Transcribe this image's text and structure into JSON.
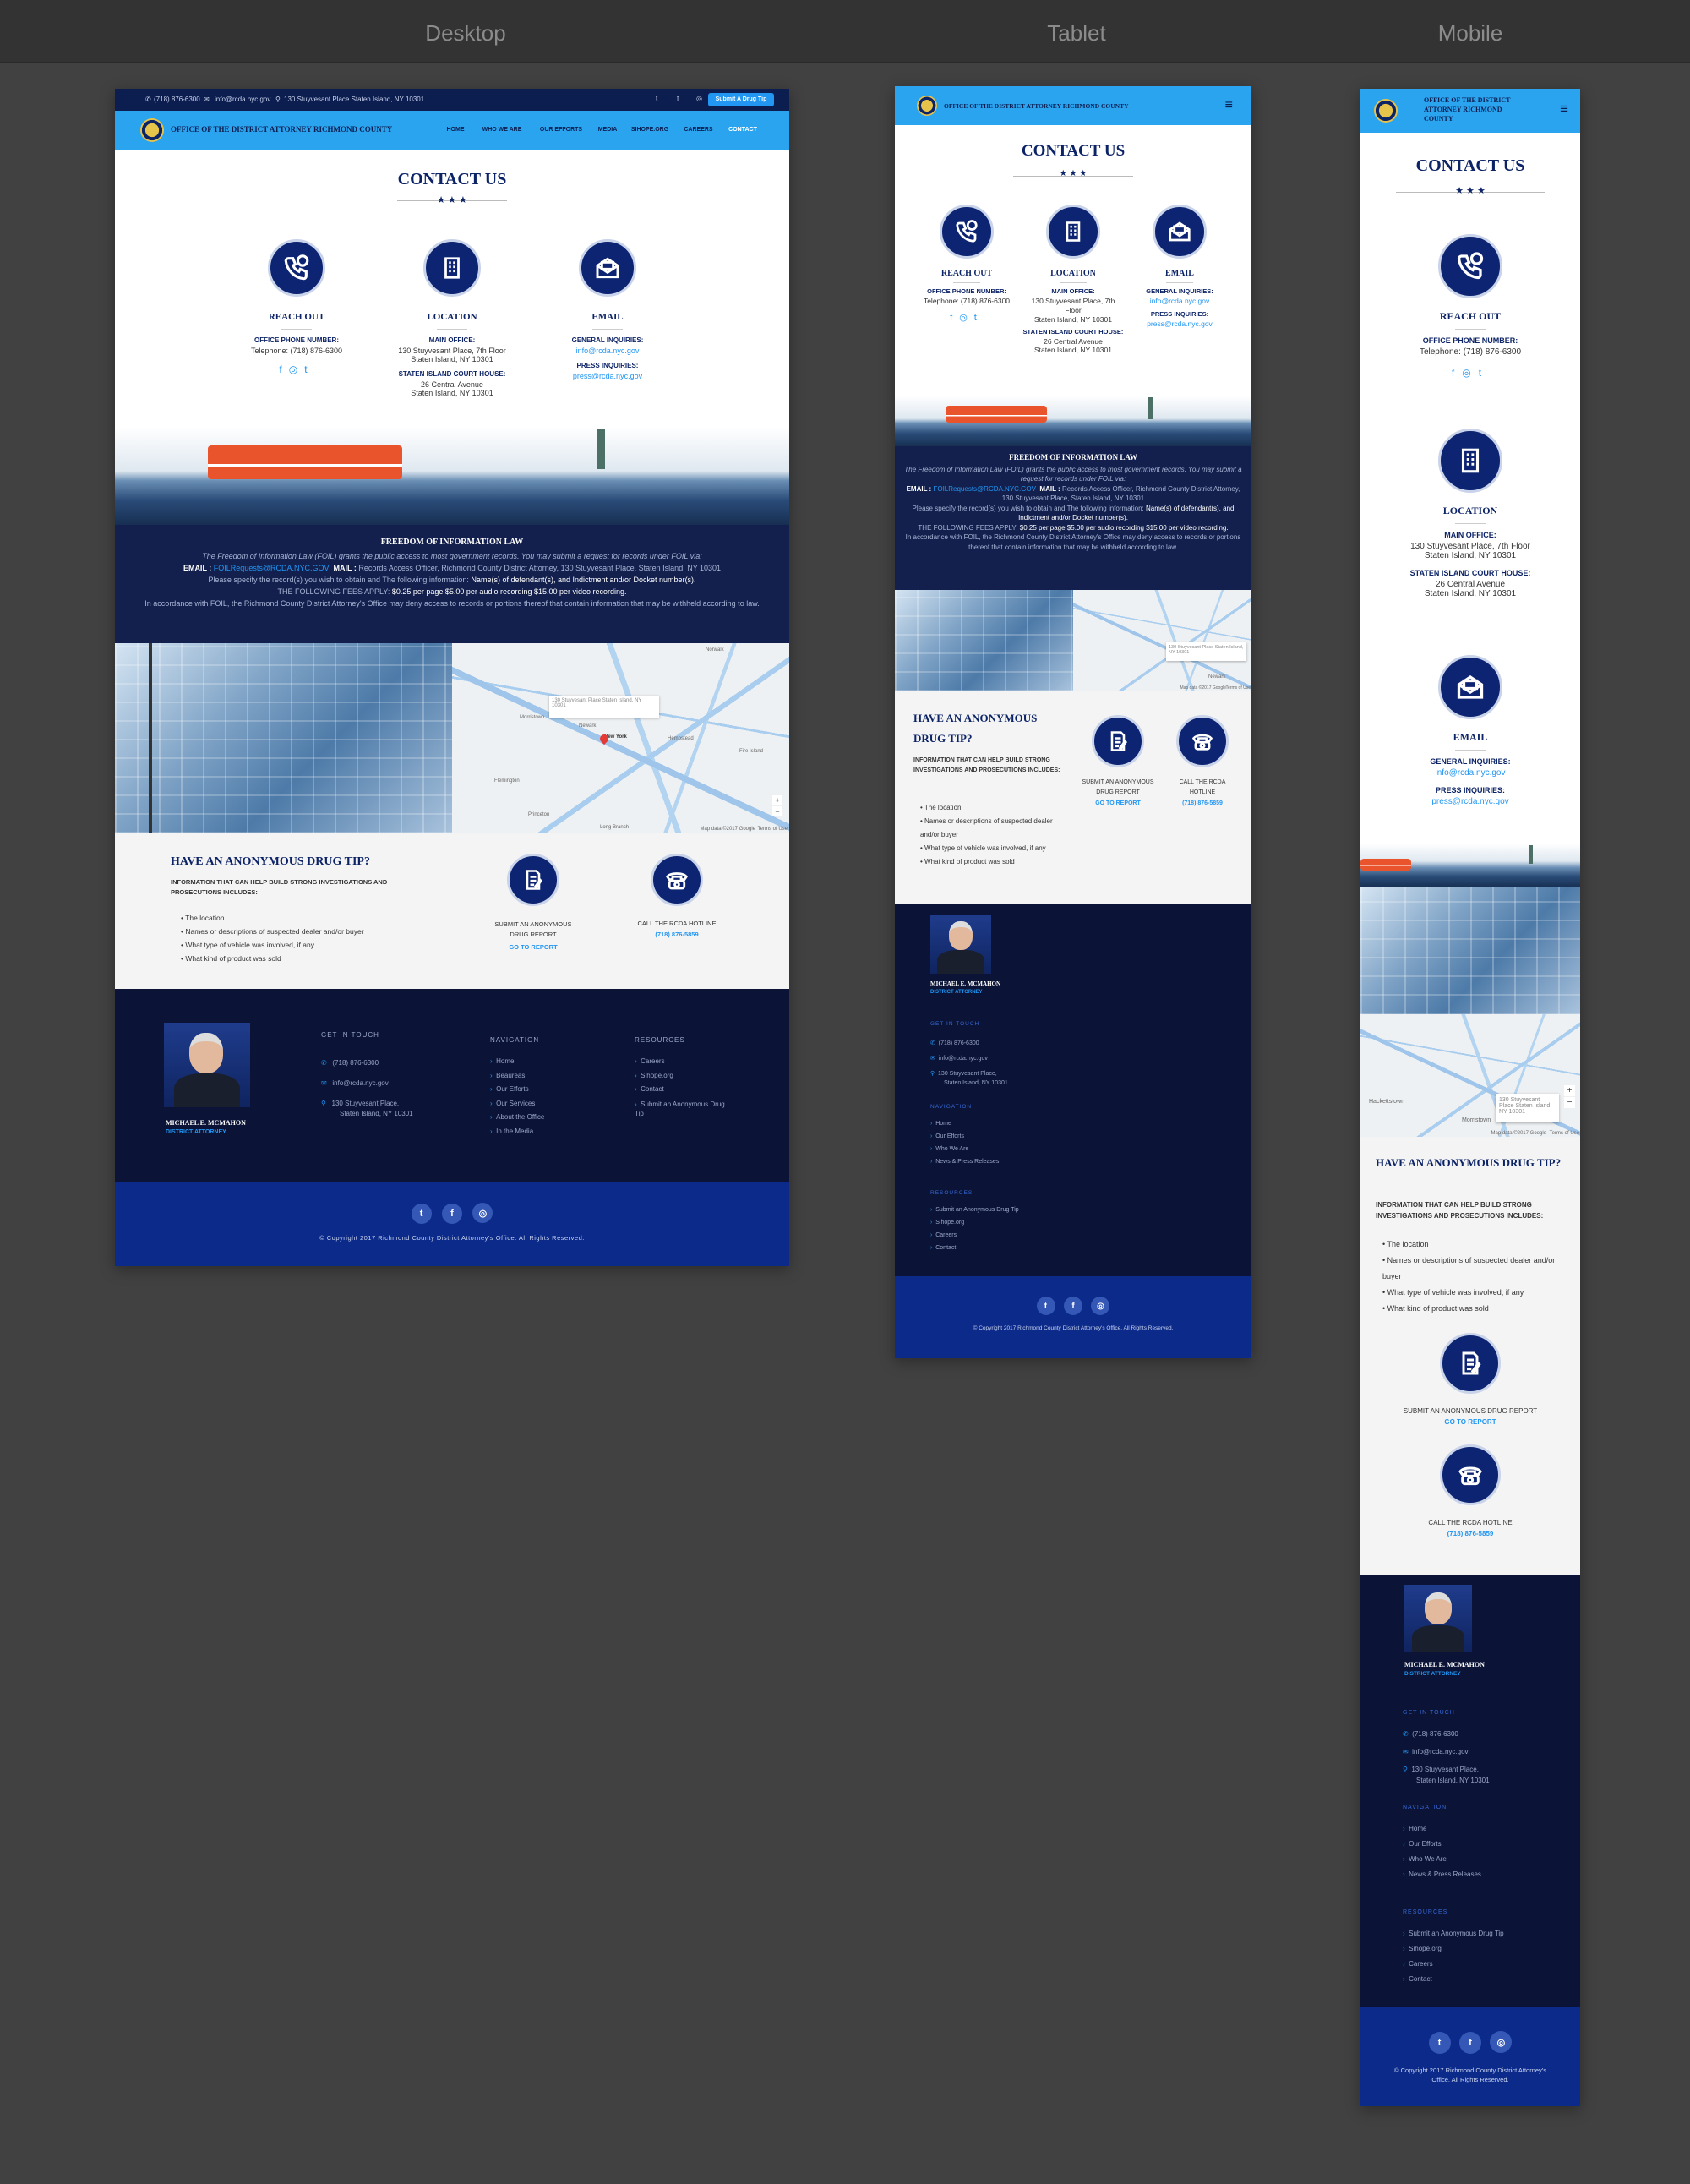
{
  "labels": {
    "desktop": "Desktop",
    "tablet": "Tablet",
    "mobile": "Mobile"
  },
  "topbar": {
    "phone": "(718) 876-6300",
    "email": "info@rcda.nyc.gov",
    "address": "130 Stuyvesant Place Staten Island, NY 10301",
    "cta": "Submit A Drug Tip"
  },
  "brand": {
    "office": "OFFICE OF THE DISTRICT ATTORNEY RICHMOND COUNTY"
  },
  "nav": [
    "HOME",
    "WHO WE ARE",
    "OUR EFFORTS",
    "MEDIA",
    "SIHOPE.ORG",
    "CAREERS",
    "CONTACT"
  ],
  "contact": {
    "title": "CONTACT US",
    "stars": "★ ★ ★",
    "reach": {
      "h": "REACH OUT",
      "l1": "OFFICE PHONE NUMBER:",
      "v1": "Telephone: (718) 876-6300"
    },
    "loc": {
      "h": "LOCATION",
      "l1": "MAIN OFFICE:",
      "v1a": "130 Stuyvesant Place, 7th Floor",
      "v1b": "Staten Island, NY 10301",
      "l2": "STATEN ISLAND COURT HOUSE:",
      "v2a": "26 Central Avenue",
      "v2b": "Staten Island, NY 10301"
    },
    "email": {
      "h": "EMAIL",
      "l1": "GENERAL INQUIRIES:",
      "v1": "info@rcda.nyc.gov",
      "l2": "PRESS INQUIRIES:",
      "v2": "press@rcda.nyc.gov"
    }
  },
  "foil": {
    "title": "FREEDOM OF INFORMATION LAW",
    "intro": "The Freedom of Information Law (FOIL) grants the public access to most government records. You may submit a request for records under FOIL via:",
    "email_label": "EMAIL :",
    "email": "FOILRequests@RCDA.NYC.GOV",
    "mail_label": "MAIL :",
    "mail": "Records Access Officer, Richmond County District Attorney, 130 Stuyvesant Place, Staten Island, NY 10301",
    "specify": "Please specify the record(s) you wish to obtain and The following information:",
    "specify_b": "Name(s) of defendant(s), and Indictment and/or Docket number(s).",
    "fees_label": "THE FOLLOWING FEES APPLY:",
    "fees": "$0.25 per page $5.00 per audio recording $15.00 per video recording.",
    "deny": "In accordance with FOIL, the Richmond County District Attorney's Office may deny access to records or portions thereof that contain information that may be withheld according to law."
  },
  "map": {
    "popup": "130 Stuyvesant Place Staten Island, NY 10301",
    "attr": "Map data ©2017 Google",
    "terms": "Terms of Use",
    "towns": [
      "Newark",
      "New York",
      "Morristown",
      "Hempstead",
      "Flemington",
      "Princeton",
      "Long Branch",
      "Fire Island",
      "Norwalk",
      "Hackettstown"
    ]
  },
  "tip": {
    "title": "HAVE AN ANONYMOUS DRUG TIP?",
    "sub": "INFORMATION THAT CAN HELP BUILD STRONG INVESTIGATIONS AND PROSECUTIONS INCLUDES:",
    "items": [
      "The location",
      "Names or descriptions of suspected dealer and/or buyer",
      "What type of vehicle was involved, if any",
      "What kind of product was sold"
    ],
    "report": "SUBMIT AN ANONYMOUS DRUG REPORT",
    "report_link": "GO TO REPORT",
    "hotline": "CALL THE RCDA HOTLINE",
    "hotline_num": "(718) 876-5859"
  },
  "footer": {
    "name": "MICHAEL E. MCMAHON",
    "role": "DISTRICT ATTORNEY",
    "git": "GET IN TOUCH",
    "phone": "(718) 876-6300",
    "email": "info@rcda.nyc.gov",
    "addr1": "130 Stuyvesant Place,",
    "addr2": "Staten Island, NY 10301",
    "nav_h": "NAVIGATION",
    "nav": [
      "Home",
      "Beaureas",
      "Our Efforts",
      "Our Services",
      "About the Office",
      "In the Media"
    ],
    "res_h": "RESOURCES",
    "res": [
      "Careers",
      "Sihope.org",
      "Contact",
      "Submit an Anonymous Drug Tip"
    ],
    "nav_t": [
      "Home",
      "Our Efforts",
      "Who We Are",
      "News & Press Releases"
    ],
    "res_t": [
      "Submit an Anonymous Drug Tip",
      "Sihope.org",
      "Careers",
      "Contact"
    ],
    "copyright": "© Copyright 2017 Richmond County District Attorney's Office. All Rights Reserved."
  }
}
